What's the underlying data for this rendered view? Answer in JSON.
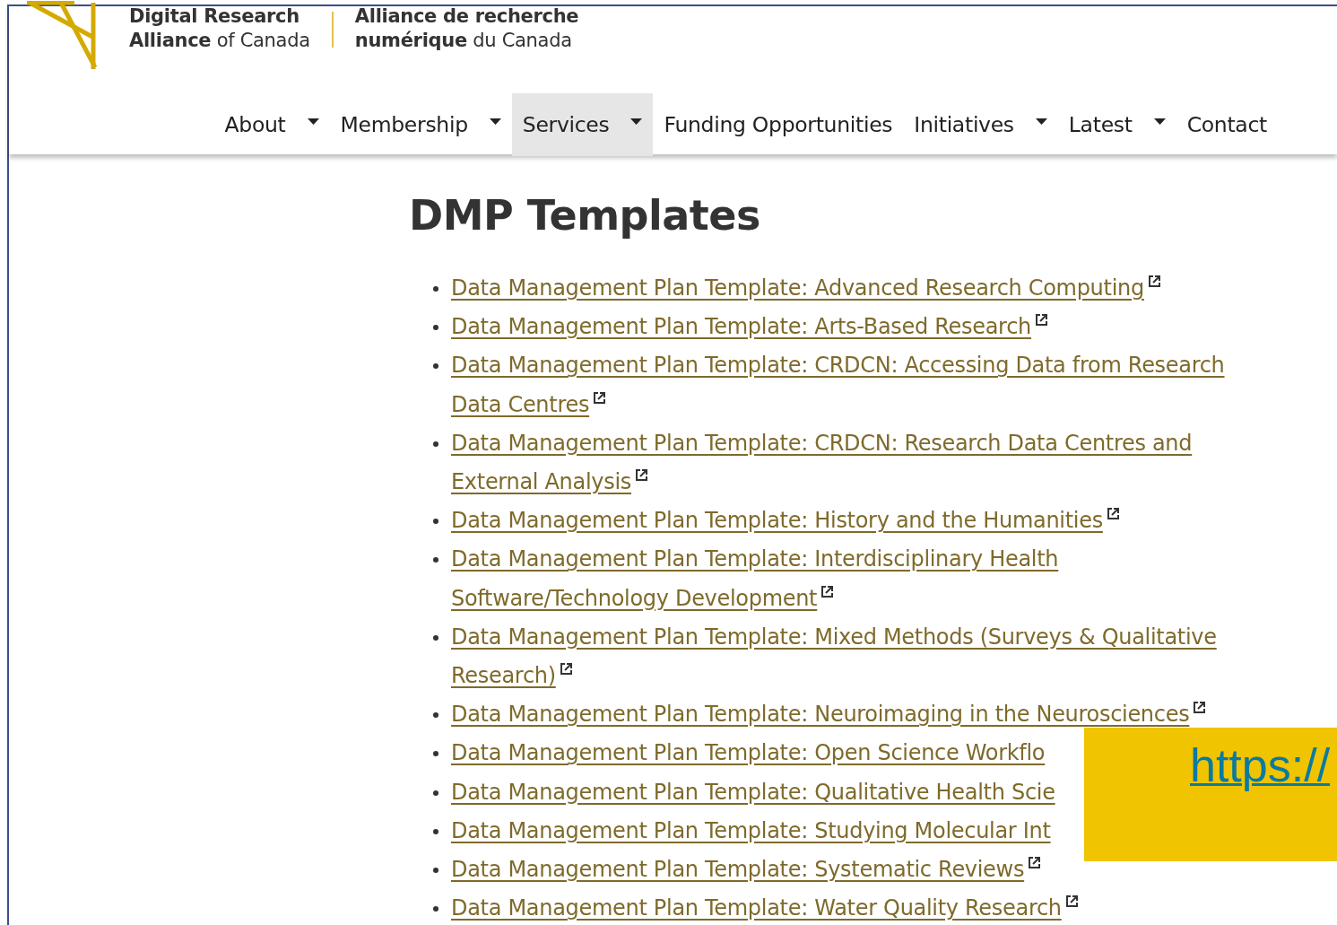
{
  "logo": {
    "english": [
      "Digital Research",
      "**Alliance** of Canada"
    ],
    "french": [
      "Alliance de recherche",
      "**numérique** du Canada"
    ]
  },
  "nav": [
    {
      "label": "About",
      "dropdown": true,
      "selected": false
    },
    {
      "label": "Membership",
      "dropdown": true,
      "selected": false
    },
    {
      "label": "Services",
      "dropdown": true,
      "selected": true
    },
    {
      "label": "Funding Opportunities",
      "dropdown": false,
      "selected": false
    },
    {
      "label": "Initiatives",
      "dropdown": true,
      "selected": false
    },
    {
      "label": "Latest",
      "dropdown": true,
      "selected": false
    },
    {
      "label": "Contact",
      "dropdown": false,
      "selected": false
    }
  ],
  "title": "DMP Templates",
  "links": [
    {
      "text": "Data Management Plan Template: Advanced Research Computing",
      "external": true
    },
    {
      "text": "Data Management Plan Template: Arts-Based Research",
      "external": true
    },
    {
      "text": "Data Management Plan Template: CRDCN: Accessing Data from Research Data Centres",
      "external": true
    },
    {
      "text": "Data Management Plan Template: CRDCN: Research Data Centres and External Analysis",
      "external": true
    },
    {
      "text": "Data Management Plan Template: History and the Humanities",
      "external": true
    },
    {
      "text": "Data Management Plan Template: Interdisciplinary Health Software/Technology Development",
      "external": true
    },
    {
      "text": "Data Management Plan Template: Mixed Methods (Surveys & Qualitative Research)",
      "external": true
    },
    {
      "text": "Data Management Plan Template: Neuroimaging in the Neurosciences",
      "external": true
    },
    {
      "text": "Data Management Plan Template: Open Science Workflo",
      "external": false
    },
    {
      "text": "Data Management Plan Template: Qualitative Health Scie",
      "external": false
    },
    {
      "text": "Data Management Plan Template: Studying Molecular Int",
      "external": false
    },
    {
      "text": "Data Management Plan Template: Systematic Reviews",
      "external": true
    },
    {
      "text": "Data Management Plan Template: Water Quality Research",
      "external": true
    }
  ],
  "overlay": {
    "link": "https://"
  }
}
